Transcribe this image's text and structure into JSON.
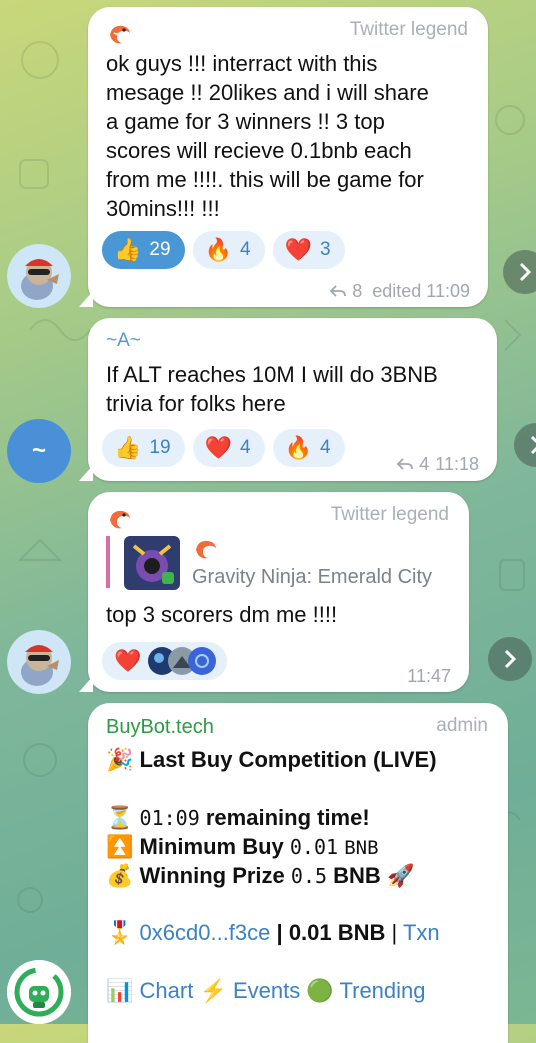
{
  "messages": [
    {
      "sender_tag": "Twitter legend",
      "text": "ok guys !!! interract with this\nmesage !! 20likes and i will share\na game for 3 winners !! 3 top\nscores will recieve 0.1bnb each\nfrom me !!!!. this will be game for\n30mins!!! !!!",
      "reactions": [
        {
          "emoji": "👍",
          "count": "29",
          "active": true
        },
        {
          "emoji": "🔥",
          "count": "4",
          "active": false
        },
        {
          "emoji": "❤️",
          "count": "3",
          "active": false
        }
      ],
      "replies": "8",
      "time": "edited 11:09"
    },
    {
      "sender_name": "~A~",
      "text": "If ALT reaches 10M I will do 3BNB\ntrivia for folks here",
      "reactions": [
        {
          "emoji": "👍",
          "count": "19",
          "active": false
        },
        {
          "emoji": "❤️",
          "count": "4",
          "active": false
        },
        {
          "emoji": "🔥",
          "count": "4",
          "active": false
        }
      ],
      "replies": "4",
      "time": "11:18",
      "avatar_letter": "~"
    },
    {
      "sender_tag": "Twitter legend",
      "game_title": "Gravity Ninja: Emerald City",
      "text": "top 3 scorers dm me !!!!",
      "reactions": [
        {
          "emoji": "❤️"
        }
      ],
      "time": "11:47"
    },
    {
      "sender_name": "BuyBot.tech",
      "sender_tag": "admin",
      "headline_emoji": "🎉",
      "headline": "Last Buy Competition (LIVE)",
      "timer_emoji": "⏳",
      "timer_value": "01:09",
      "timer_label": "remaining time!",
      "min_emoji": "⏫",
      "min_label": "Minimum Buy",
      "min_value": "0.01",
      "min_unit": "BNB",
      "prize_emoji": "💰",
      "prize_label": "Winning Prize",
      "prize_value": "0.5",
      "prize_unit": "BNB",
      "prize_tail": "🚀",
      "leader_emoji": "🎖️",
      "leader_addr": "0x6cd0...f3ce",
      "leader_sep1": "|",
      "leader_amount": "0.01 BNB",
      "leader_sep2": "|",
      "leader_txn": "Txn",
      "links": [
        {
          "emoji": "📊",
          "label": "Chart"
        },
        {
          "emoji": "⚡",
          "label": "Events"
        },
        {
          "emoji": "🟢",
          "label": "Trending"
        }
      ]
    }
  ]
}
